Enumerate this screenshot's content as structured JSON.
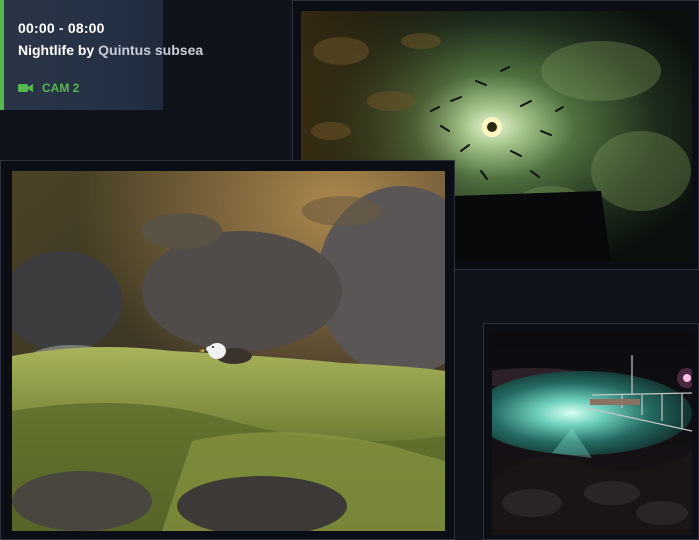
{
  "info": {
    "time_range": "00:00 - 08:00",
    "title_lead": "Nightlife by",
    "title_tail": "Quintus subsea",
    "camera_label": "CAM 2"
  },
  "colors": {
    "accent": "#56b84e",
    "card_bg": "#2b3547",
    "page_bg": "#0f131b",
    "frame_border": "#2b323d"
  },
  "icons": {
    "camera": "video-camera-icon"
  }
}
